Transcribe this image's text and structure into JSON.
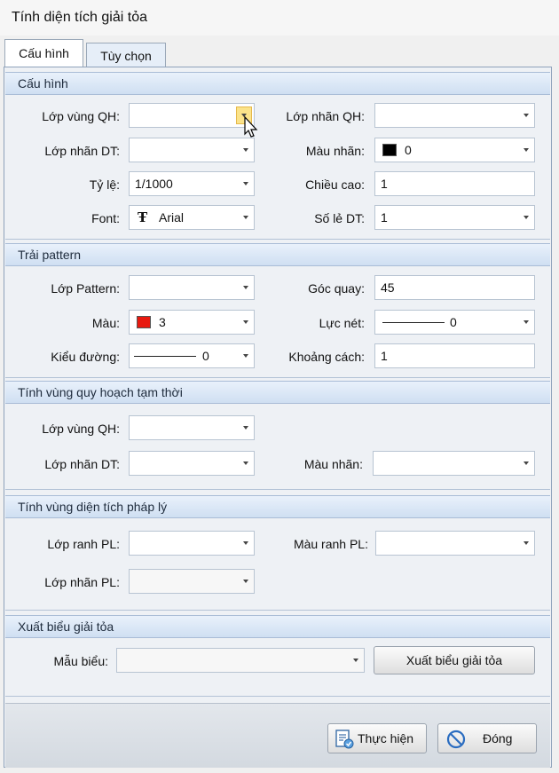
{
  "window": {
    "title": "Tính diện tích giải tỏa"
  },
  "tabs": [
    {
      "label": "Cấu hình"
    },
    {
      "label": "Tùy chọn"
    }
  ],
  "sections": {
    "config": {
      "title": "Cấu hình",
      "lop_vung_qh": {
        "label": "Lớp vùng QH:",
        "value": ""
      },
      "lop_nhan_qh": {
        "label": "Lớp nhãn QH:",
        "value": ""
      },
      "lop_nhan_dt": {
        "label": "Lớp nhãn DT:",
        "value": ""
      },
      "mau_nhan": {
        "label": "Màu nhãn:",
        "value": "0",
        "color": "#000000"
      },
      "ty_le": {
        "label": "Tỷ lệ:",
        "value": "1/1000"
      },
      "chieu_cao": {
        "label": "Chiều cao:",
        "value": "1"
      },
      "font": {
        "label": "Font:",
        "value": "Arial"
      },
      "so_le_dt": {
        "label": "Số lẻ DT:",
        "value": "1"
      }
    },
    "pattern": {
      "title": "Trải pattern",
      "lop_pattern": {
        "label": "Lớp Pattern:",
        "value": ""
      },
      "goc_quay": {
        "label": "Góc quay:",
        "value": "45"
      },
      "mau": {
        "label": "Màu:",
        "value": "3",
        "color": "#e8190f"
      },
      "luc_net": {
        "label": "Lực nét:",
        "value": "0"
      },
      "kieu_duong": {
        "label": "Kiểu đường:",
        "value": "0"
      },
      "khoang_cach": {
        "label": "Khoảng cách:",
        "value": "1"
      }
    },
    "temp": {
      "title": "Tính vùng quy hoạch tạm thời",
      "lop_vung_qh": {
        "label": "Lớp vùng QH:",
        "value": ""
      },
      "lop_nhan_dt": {
        "label": "Lớp nhãn DT:",
        "value": ""
      },
      "mau_nhan": {
        "label": "Màu nhãn:",
        "value": ""
      }
    },
    "legal": {
      "title": "Tính vùng diện tích pháp lý",
      "lop_ranh_pl": {
        "label": "Lớp ranh PL:",
        "value": ""
      },
      "mau_ranh_pl": {
        "label": "Màu ranh PL:",
        "value": ""
      },
      "lop_nhan_pl": {
        "label": "Lớp nhãn PL:",
        "value": ""
      }
    },
    "export": {
      "title": "Xuất biểu giải tỏa",
      "mau_bieu": {
        "label": "Mẫu biểu:",
        "value": ""
      },
      "button": "Xuất biểu giải tỏa"
    }
  },
  "footer": {
    "run_label": "Thực hiện",
    "close_label": "Đóng"
  },
  "icons": {
    "font": "font-icon",
    "run": "run-document-icon",
    "close": "no-entry-icon"
  }
}
